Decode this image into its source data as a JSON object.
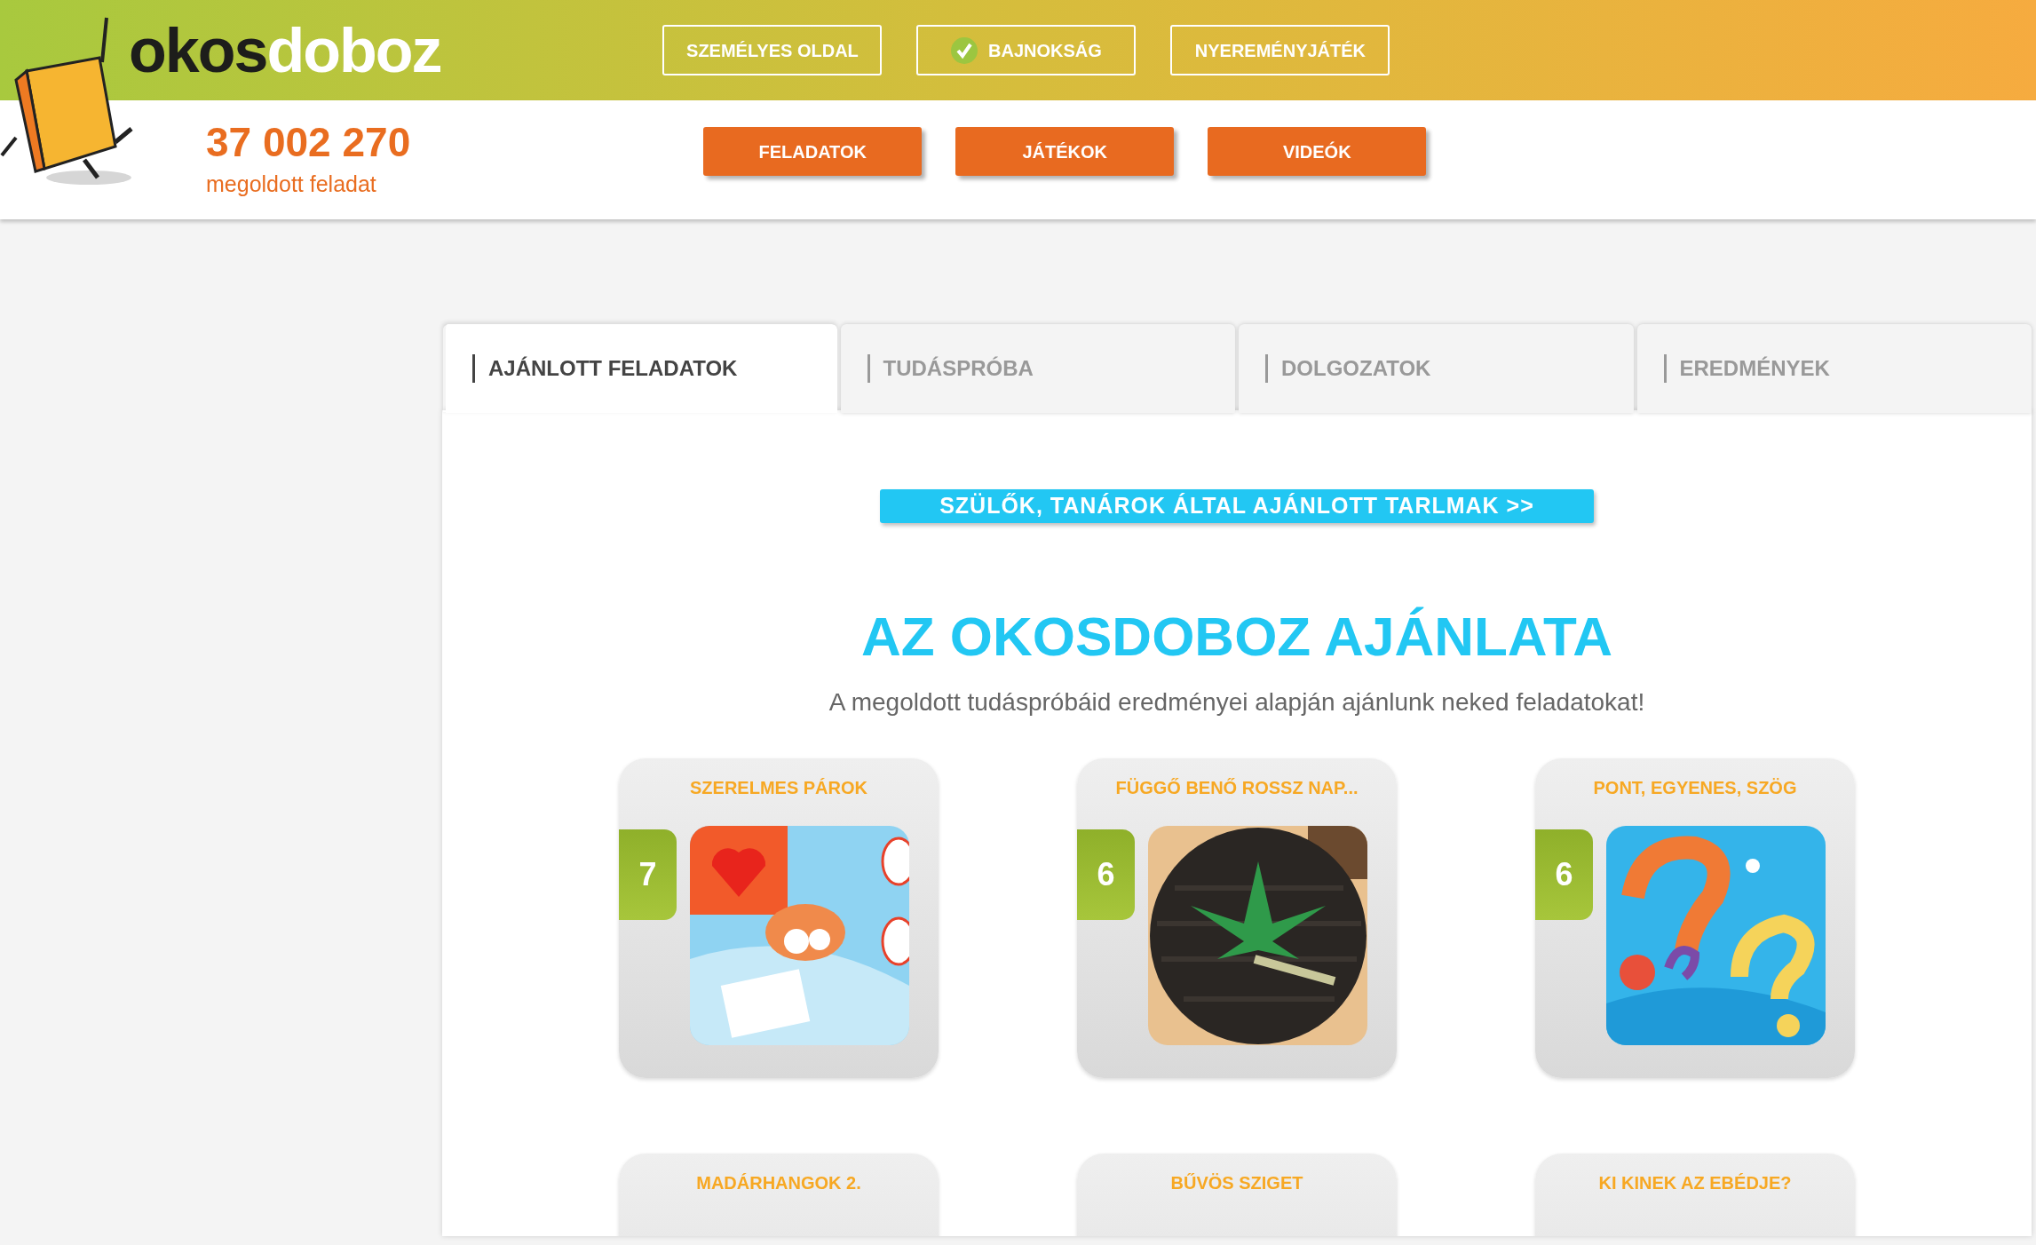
{
  "logo": {
    "parts": [
      "okos",
      "doboz"
    ]
  },
  "counter": {
    "value": "37 002 270",
    "label": "megoldott feladat"
  },
  "top_nav": [
    {
      "label": "SZEMÉLYES OLDAL",
      "checked": false
    },
    {
      "label": "BAJNOKSÁG",
      "checked": true
    },
    {
      "label": "NYEREMÉNYJÁTÉK",
      "checked": false
    }
  ],
  "main_nav": [
    "FELADATOK",
    "JÁTÉKOK",
    "VIDEÓK"
  ],
  "tabs": [
    {
      "label": "AJÁNLOTT FELADATOK",
      "selected": true
    },
    {
      "label": "TUDÁSPRÓBA",
      "selected": false
    },
    {
      "label": "DOLGOZATOK",
      "selected": false
    },
    {
      "label": "EREDMÉNYEK",
      "selected": false
    }
  ],
  "recommended_button": "SZÜLŐK, TANÁROK ÁLTAL AJÁNLOTT TARLMAK >>",
  "heading": "AZ OKOSDOBOZ AJÁNLATA",
  "subtitle": "A megoldott tudáspróbáid eredményei alapján ajánlunk neked feladatokat!",
  "cards": [
    {
      "title": "SZERELMES PÁROK",
      "grade": "7",
      "kind": "picture"
    },
    {
      "title": "FÜGGŐ BENŐ ROSSZ NAP...",
      "grade": "6",
      "kind": "picture"
    },
    {
      "title": "PONT, EGYENES, SZÖG",
      "grade": "6",
      "kind": "picture"
    },
    {
      "title": "MADÁRHANGOK 2."
    },
    {
      "title": "BŰVÖS SZIGET"
    },
    {
      "title": "KI KINEK AZ EBÉDJE?"
    }
  ]
}
